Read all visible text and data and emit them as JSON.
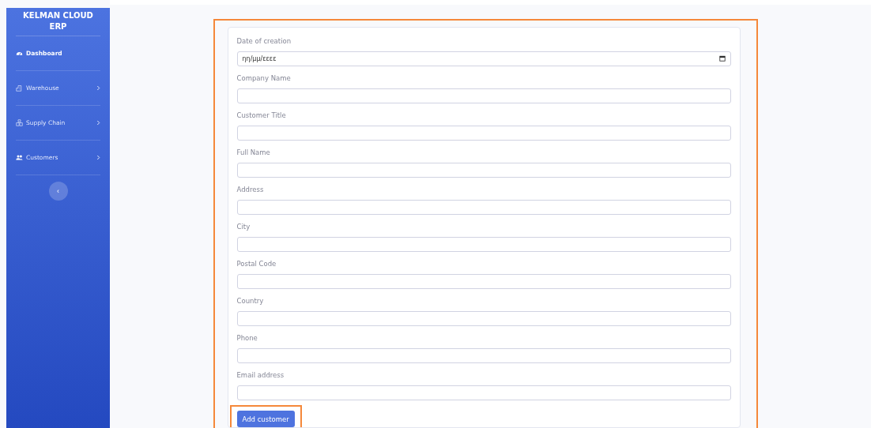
{
  "sidebar": {
    "brand": "KELMAN CLOUD ERP",
    "items": [
      {
        "label": "Dashboard",
        "selected": true,
        "expandable": false
      },
      {
        "label": "Warehouse",
        "selected": false,
        "expandable": true
      },
      {
        "label": "Supply Chain",
        "selected": false,
        "expandable": true
      },
      {
        "label": "Customers",
        "selected": false,
        "expandable": true
      }
    ],
    "collapse_button": "‹"
  },
  "form": {
    "fields": [
      {
        "label": "Date of creation",
        "kind": "date",
        "placeholder": "ηη/μμ/εεεε"
      },
      {
        "label": "Company Name",
        "kind": "text"
      },
      {
        "label": "Customer Title",
        "kind": "text"
      },
      {
        "label": "Full Name",
        "kind": "text"
      },
      {
        "label": "Address",
        "kind": "text"
      },
      {
        "label": "City",
        "kind": "text"
      },
      {
        "label": "Postal Code",
        "kind": "text"
      },
      {
        "label": "Country",
        "kind": "text"
      },
      {
        "label": "Phone",
        "kind": "text"
      },
      {
        "label": "Email address",
        "kind": "text"
      }
    ],
    "submit": "Add customer"
  }
}
